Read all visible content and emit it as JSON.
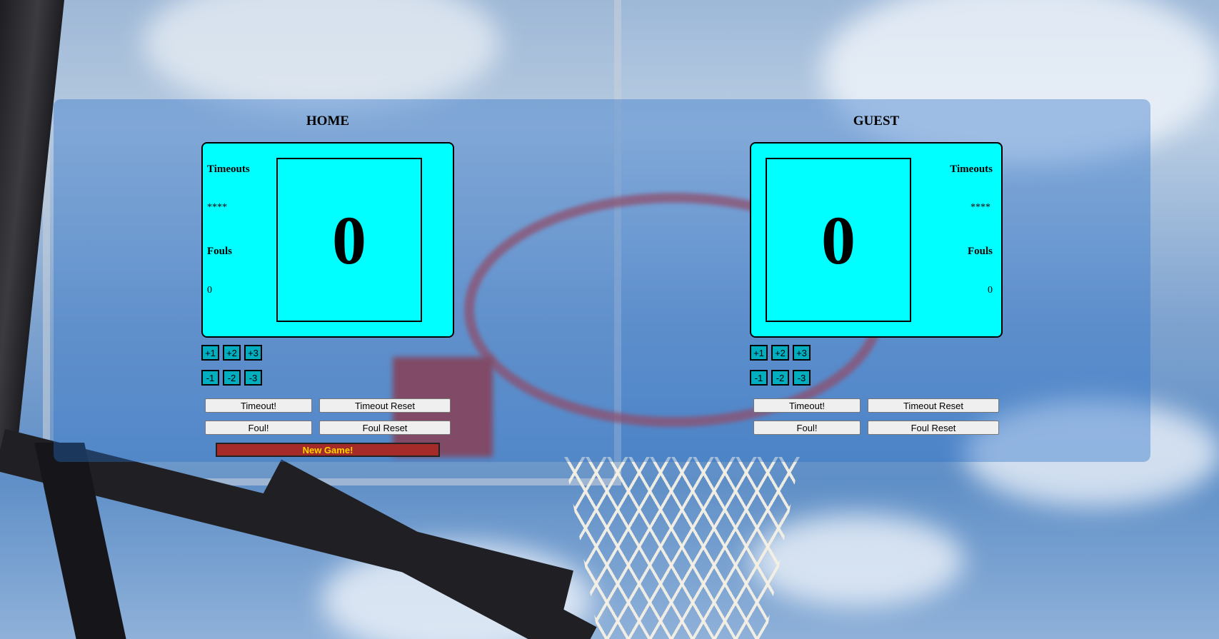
{
  "home": {
    "title": "HOME",
    "score": "0",
    "timeouts_label": "Timeouts",
    "timeouts_value": "****",
    "fouls_label": "Fouls",
    "fouls_value": "0",
    "plus_buttons": [
      "+1",
      "+2",
      "+3"
    ],
    "minus_buttons": [
      "-1",
      "-2",
      "-3"
    ],
    "timeout_button": "Timeout!",
    "timeout_reset_button": "Timeout Reset",
    "foul_button": "Foul!",
    "foul_reset_button": "Foul Reset"
  },
  "guest": {
    "title": "GUEST",
    "score": "0",
    "timeouts_label": "Timeouts",
    "timeouts_value": "****",
    "fouls_label": "Fouls",
    "fouls_value": "0",
    "plus_buttons": [
      "+1",
      "+2",
      "+3"
    ],
    "minus_buttons": [
      "-1",
      "-2",
      "-3"
    ],
    "timeout_button": "Timeout!",
    "timeout_reset_button": "Timeout Reset",
    "foul_button": "Foul!",
    "foul_reset_button": "Foul Reset"
  },
  "new_game_button": "New Game!",
  "colors": {
    "scoreboard": "#00ffff",
    "point_button": "#00aec0",
    "new_game_bg": "#a52a2a",
    "new_game_text": "#ffd400"
  }
}
